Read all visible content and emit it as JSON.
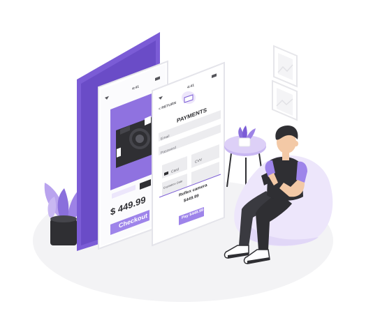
{
  "colors": {
    "accent": "#7b5cd6",
    "accent_light": "#c9b8f2",
    "accent_pale": "#ede6fb",
    "dark": "#2f2f33",
    "skin": "#f3c9a6",
    "floor": "#f2f2f4"
  },
  "product_screen": {
    "status_time": "4:41",
    "price": "$ 449.99",
    "checkout_label": "Checkout"
  },
  "payment_screen": {
    "status_time": "4:41",
    "return_label": "< RETURN",
    "title": "PAYMENTS",
    "email_label": "Email",
    "password_label": "Password",
    "card_label": "Card",
    "cvv_label": "CVV",
    "expiration_label": "Expiration Date",
    "product_name": "Reflex camera",
    "product_price": "$449.99",
    "pay_button_label": "Pay $449.99"
  },
  "icons": {
    "wifi": "wifi-icon",
    "battery": "battery-icon",
    "card": "credit-card-icon",
    "camera": "camera-icon"
  }
}
